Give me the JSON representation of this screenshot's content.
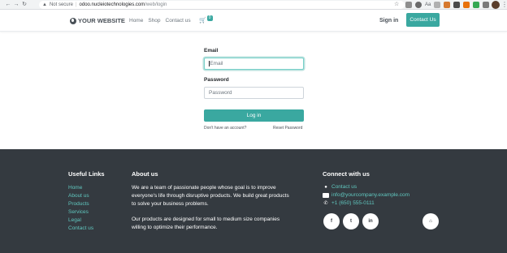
{
  "browser": {
    "not_secure": "Not secure",
    "url_host": "odoo.nucleiotechnologies.com",
    "url_path": "/web/login",
    "ext_aa": "Aa"
  },
  "header": {
    "brand": "YOUR WEBSITE",
    "nav": [
      "Home",
      "Shop",
      "Contact us"
    ],
    "cart_count": "0",
    "signin": "Sign in",
    "contact_button": "Contact Us"
  },
  "login": {
    "email_label": "Email",
    "email_placeholder": "Email",
    "password_label": "Password",
    "password_placeholder": "Password",
    "login_button": "Log in",
    "no_account": "Don't have an account?",
    "reset_password": "Reset Password"
  },
  "footer": {
    "useful_links_title": "Useful Links",
    "useful_links": [
      "Home",
      "About us",
      "Products",
      "Services",
      "Legal",
      "Contact us"
    ],
    "about_title": "About us",
    "about_p1": "We are a team of passionate people whose goal is to improve everyone's life through disruptive products. We build great products to solve your business problems.",
    "about_p2": "Our products are designed for small to medium size companies willing to optimize their performance.",
    "connect_title": "Connect with us",
    "contact_us": "Contact us",
    "email": "info@yourcompany.example.com",
    "phone": "+1 (650) 555-0111",
    "social": [
      "f",
      "t",
      "in",
      "home"
    ]
  },
  "colors": {
    "accent": "#3aa8a0",
    "footer_bg": "#343a40",
    "link": "#60c6be"
  }
}
